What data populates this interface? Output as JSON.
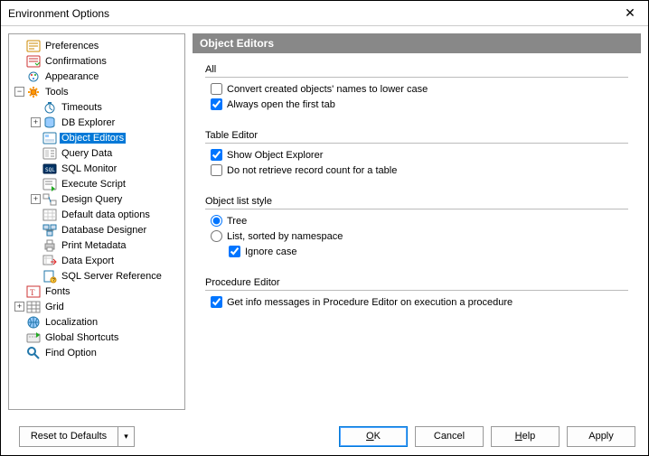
{
  "window": {
    "title": "Environment Options"
  },
  "tree": [
    {
      "label": "Preferences",
      "level": 0,
      "expander": "",
      "icon": "pref"
    },
    {
      "label": "Confirmations",
      "level": 0,
      "expander": "",
      "icon": "confirm"
    },
    {
      "label": "Appearance",
      "level": 0,
      "expander": "",
      "icon": "appearance"
    },
    {
      "label": "Tools",
      "level": 0,
      "expander": "-",
      "icon": "tools"
    },
    {
      "label": "Timeouts",
      "level": 1,
      "expander": "",
      "icon": "timeout"
    },
    {
      "label": "DB Explorer",
      "level": 1,
      "expander": "+",
      "icon": "dbexplorer"
    },
    {
      "label": "Object Editors",
      "level": 1,
      "expander": "",
      "icon": "objeditor",
      "selected": true
    },
    {
      "label": "Query Data",
      "level": 1,
      "expander": "",
      "icon": "querydata"
    },
    {
      "label": "SQL Monitor",
      "level": 1,
      "expander": "",
      "icon": "sqlmonitor"
    },
    {
      "label": "Execute Script",
      "level": 1,
      "expander": "",
      "icon": "execscript"
    },
    {
      "label": "Design Query",
      "level": 1,
      "expander": "+",
      "icon": "designquery"
    },
    {
      "label": "Default data options",
      "level": 1,
      "expander": "",
      "icon": "dataopt"
    },
    {
      "label": "Database Designer",
      "level": 1,
      "expander": "",
      "icon": "dbdesigner"
    },
    {
      "label": "Print Metadata",
      "level": 1,
      "expander": "",
      "icon": "printmeta"
    },
    {
      "label": "Data Export",
      "level": 1,
      "expander": "",
      "icon": "dataexport"
    },
    {
      "label": "SQL Server Reference",
      "level": 1,
      "expander": "",
      "icon": "sqlref"
    },
    {
      "label": "Fonts",
      "level": 0,
      "expander": "",
      "icon": "fonts"
    },
    {
      "label": "Grid",
      "level": 0,
      "expander": "+",
      "icon": "grid"
    },
    {
      "label": "Localization",
      "level": 0,
      "expander": "",
      "icon": "localization"
    },
    {
      "label": "Global Shortcuts",
      "level": 0,
      "expander": "",
      "icon": "shortcuts"
    },
    {
      "label": "Find Option",
      "level": 0,
      "expander": "",
      "icon": "findopt"
    }
  ],
  "panel": {
    "header": "Object Editors",
    "groups": {
      "all": {
        "title": "All",
        "convert_lower": {
          "label": "Convert created objects' names to lower case",
          "checked": false
        },
        "open_first_tab": {
          "label": "Always open the first tab",
          "checked": true
        }
      },
      "table_editor": {
        "title": "Table Editor",
        "show_obj_explorer": {
          "label": "Show Object Explorer",
          "checked": true
        },
        "no_record_count": {
          "label": "Do not retrieve record count for a table",
          "checked": false
        }
      },
      "list_style": {
        "title": "Object list style",
        "tree": {
          "label": "Tree"
        },
        "list_ns": {
          "label": "List, sorted by namespace"
        },
        "ignore_case": {
          "label": "Ignore case",
          "checked": true
        },
        "selected": "tree"
      },
      "proc_editor": {
        "title": "Procedure Editor",
        "get_info_msgs": {
          "label": "Get info messages in Procedure Editor on execution a procedure",
          "checked": true
        }
      }
    }
  },
  "footer": {
    "reset": "Reset to Defaults",
    "ok": "OK",
    "cancel": "Cancel",
    "help": "Help",
    "apply": "Apply"
  }
}
